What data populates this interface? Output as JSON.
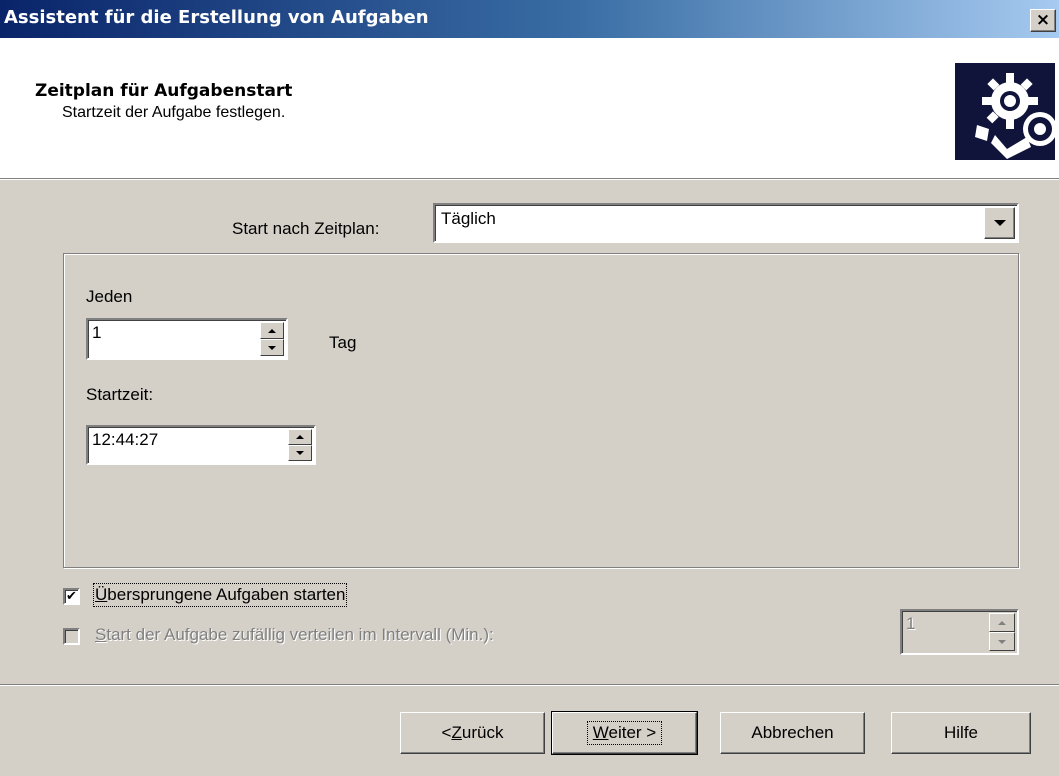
{
  "window": {
    "title": "Assistent für die Erstellung von Aufgaben",
    "close_glyph": "×"
  },
  "header": {
    "title": "Zeitplan für Aufgabenstart",
    "subtitle": "Startzeit der Aufgabe festlegen.",
    "icon": "gears-schedule-icon"
  },
  "schedule": {
    "label": "Start nach Zeitplan:",
    "selected": "Täglich"
  },
  "daily": {
    "every_label": "Jeden",
    "every_value": "1",
    "unit_label": "Tag",
    "start_time_label": "Startzeit:",
    "start_time_value": "12:44:27"
  },
  "options": {
    "skipped": {
      "pre": "",
      "access": "Ü",
      "post": "bersprungene Aufgaben starten",
      "checked": true,
      "check_glyph": "✔"
    },
    "random": {
      "pre": "",
      "access": "S",
      "post": "tart der Aufgabe zufällig verteilen im Intervall (Min.):",
      "checked": false,
      "enabled": false,
      "value": "1"
    }
  },
  "buttons": {
    "back": {
      "pre": "< ",
      "access": "Z",
      "post": "urück"
    },
    "next": {
      "pre": "",
      "access": "W",
      "post": "eiter >"
    },
    "cancel": "Abbrechen",
    "help": "Hilfe"
  }
}
